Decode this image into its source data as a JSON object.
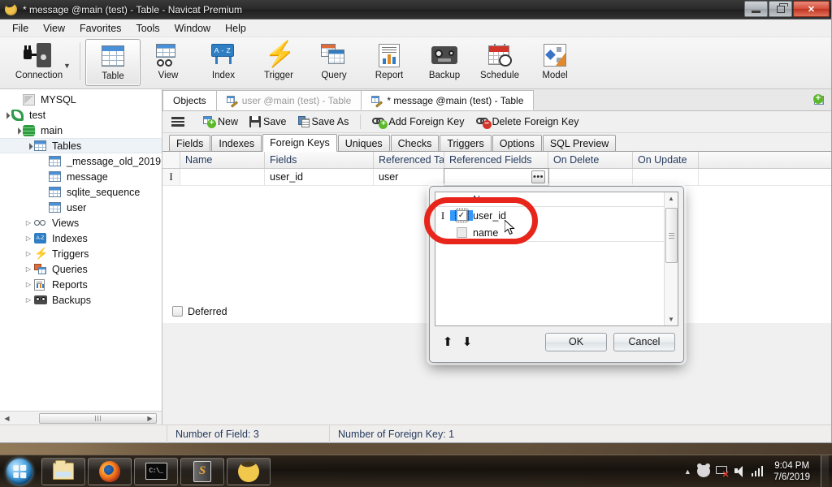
{
  "window": {
    "title": "* message @main (test) - Table - Navicat Premium",
    "app_icon": "navicat-icon",
    "minimize_label": "Minimize",
    "maximize_label": "Maximize",
    "close_label": "Close"
  },
  "menubar": {
    "items": [
      {
        "label": "File"
      },
      {
        "label": "View"
      },
      {
        "label": "Favorites"
      },
      {
        "label": "Tools"
      },
      {
        "label": "Window"
      },
      {
        "label": "Help"
      }
    ]
  },
  "ribbon": {
    "items": [
      {
        "label": "Connection",
        "icon": "connection-icon",
        "selected": false
      },
      {
        "label": "Table",
        "icon": "table-icon",
        "selected": true
      },
      {
        "label": "View",
        "icon": "view-icon",
        "selected": false
      },
      {
        "label": "Index",
        "icon": "index-icon",
        "selected": false
      },
      {
        "label": "Trigger",
        "icon": "trigger-icon",
        "selected": false
      },
      {
        "label": "Query",
        "icon": "query-icon",
        "selected": false
      },
      {
        "label": "Report",
        "icon": "report-icon",
        "selected": false
      },
      {
        "label": "Backup",
        "icon": "backup-icon",
        "selected": false
      },
      {
        "label": "Schedule",
        "icon": "schedule-icon",
        "selected": false
      },
      {
        "label": "Model",
        "icon": "model-icon",
        "selected": false
      }
    ]
  },
  "sidebar": {
    "nodes": [
      {
        "label": "MYSQL",
        "indent": 1,
        "twisty": "none",
        "icon": "mysql-icon",
        "selected": false
      },
      {
        "label": "test",
        "indent": 0,
        "twisty": "open",
        "icon": "connection-leaf-icon",
        "selected": false
      },
      {
        "label": "main",
        "indent": 1,
        "twisty": "open",
        "icon": "database-icon",
        "selected": false
      },
      {
        "label": "Tables",
        "indent": 2,
        "twisty": "open",
        "icon": "table-icon",
        "selected": true
      },
      {
        "label": "_message_old_2019",
        "indent": 4,
        "twisty": "none",
        "icon": "table-icon",
        "selected": false
      },
      {
        "label": "message",
        "indent": 4,
        "twisty": "none",
        "icon": "table-icon",
        "selected": false
      },
      {
        "label": "sqlite_sequence",
        "indent": 4,
        "twisty": "none",
        "icon": "table-icon",
        "selected": false
      },
      {
        "label": "user",
        "indent": 4,
        "twisty": "none",
        "icon": "table-icon",
        "selected": false
      },
      {
        "label": "Views",
        "indent": 2,
        "twisty": "closed",
        "icon": "views-icon",
        "selected": false
      },
      {
        "label": "Indexes",
        "indent": 2,
        "twisty": "closed",
        "icon": "index-icon",
        "selected": false
      },
      {
        "label": "Triggers",
        "indent": 2,
        "twisty": "closed",
        "icon": "trigger-icon",
        "selected": false
      },
      {
        "label": "Queries",
        "indent": 2,
        "twisty": "closed",
        "icon": "query-icon",
        "selected": false
      },
      {
        "label": "Reports",
        "indent": 2,
        "twisty": "closed",
        "icon": "report-icon",
        "selected": false
      },
      {
        "label": "Backups",
        "indent": 2,
        "twisty": "closed",
        "icon": "backup-icon",
        "selected": false
      }
    ],
    "hscrollbar": {
      "left_arrow": "◀",
      "right_arrow": "▶"
    }
  },
  "object_tabs": {
    "tabs": [
      {
        "label": "Objects",
        "icon": "none",
        "state": "normal"
      },
      {
        "label": "user @main (test) - Table",
        "icon": "table-edit-icon",
        "state": "inactive"
      },
      {
        "label": "* message @main (test) - Table",
        "icon": "table-edit-icon",
        "state": "active"
      }
    ],
    "new_tab_icon": "new-object-tab-icon"
  },
  "editor_toolbar": {
    "menu_icon": "hamburger-menu-icon",
    "buttons": [
      {
        "label": "New",
        "icon": "new-icon"
      },
      {
        "label": "Save",
        "icon": "save-icon"
      },
      {
        "label": "Save As",
        "icon": "save-as-icon"
      },
      {
        "label": "Add Foreign Key",
        "icon": "add-foreign-key-icon"
      },
      {
        "label": "Delete Foreign Key",
        "icon": "delete-foreign-key-icon"
      }
    ]
  },
  "inner_tabs": {
    "tabs": [
      {
        "label": "Fields",
        "active": false
      },
      {
        "label": "Indexes",
        "active": false
      },
      {
        "label": "Foreign Keys",
        "active": true
      },
      {
        "label": "Uniques",
        "active": false
      },
      {
        "label": "Checks",
        "active": false
      },
      {
        "label": "Triggers",
        "active": false
      },
      {
        "label": "Options",
        "active": false
      },
      {
        "label": "SQL Preview",
        "active": false
      }
    ]
  },
  "grid": {
    "columns": [
      "Name",
      "Fields",
      "Referenced Table",
      "Referenced Fields",
      "On Delete",
      "On Update"
    ],
    "rows": [
      {
        "indicator": "I",
        "name": "",
        "fields": "user_id",
        "referenced_table": "user",
        "referenced_fields": "",
        "on_delete": "",
        "on_update": "",
        "ellipsis_label": "•••"
      }
    ],
    "deferred": {
      "label": "Deferred",
      "checked": false
    }
  },
  "dialog": {
    "list_header": "Name",
    "rows": [
      {
        "name": "user_id",
        "checked": true,
        "selected": true
      },
      {
        "name": "name",
        "checked": false,
        "selected": false
      }
    ],
    "move_up_icon": "arrow-up-icon",
    "move_down_icon": "arrow-down-icon",
    "ok_label": "OK",
    "cancel_label": "Cancel",
    "checked_glyph": "✓"
  },
  "annotation": {
    "shape": "red-ellipse-highlight",
    "color": "#e8251b"
  },
  "statusbar": {
    "field_count": "Number of Field: 3",
    "foreign_key_count": "Number of Foreign Key: 1"
  },
  "taskbar": {
    "start_label": "Start",
    "apps": [
      {
        "name": "file-explorer-icon"
      },
      {
        "name": "firefox-icon"
      },
      {
        "name": "command-prompt-icon"
      },
      {
        "name": "sublime-text-icon"
      },
      {
        "name": "navicat-icon"
      }
    ],
    "tray": {
      "chevron": "▲",
      "icons": [
        "bear-icon",
        "network-disconnected-icon",
        "volume-icon",
        "signal-icon"
      ]
    },
    "clock": {
      "time": "9:04 PM",
      "date": "7/6/2019"
    }
  }
}
